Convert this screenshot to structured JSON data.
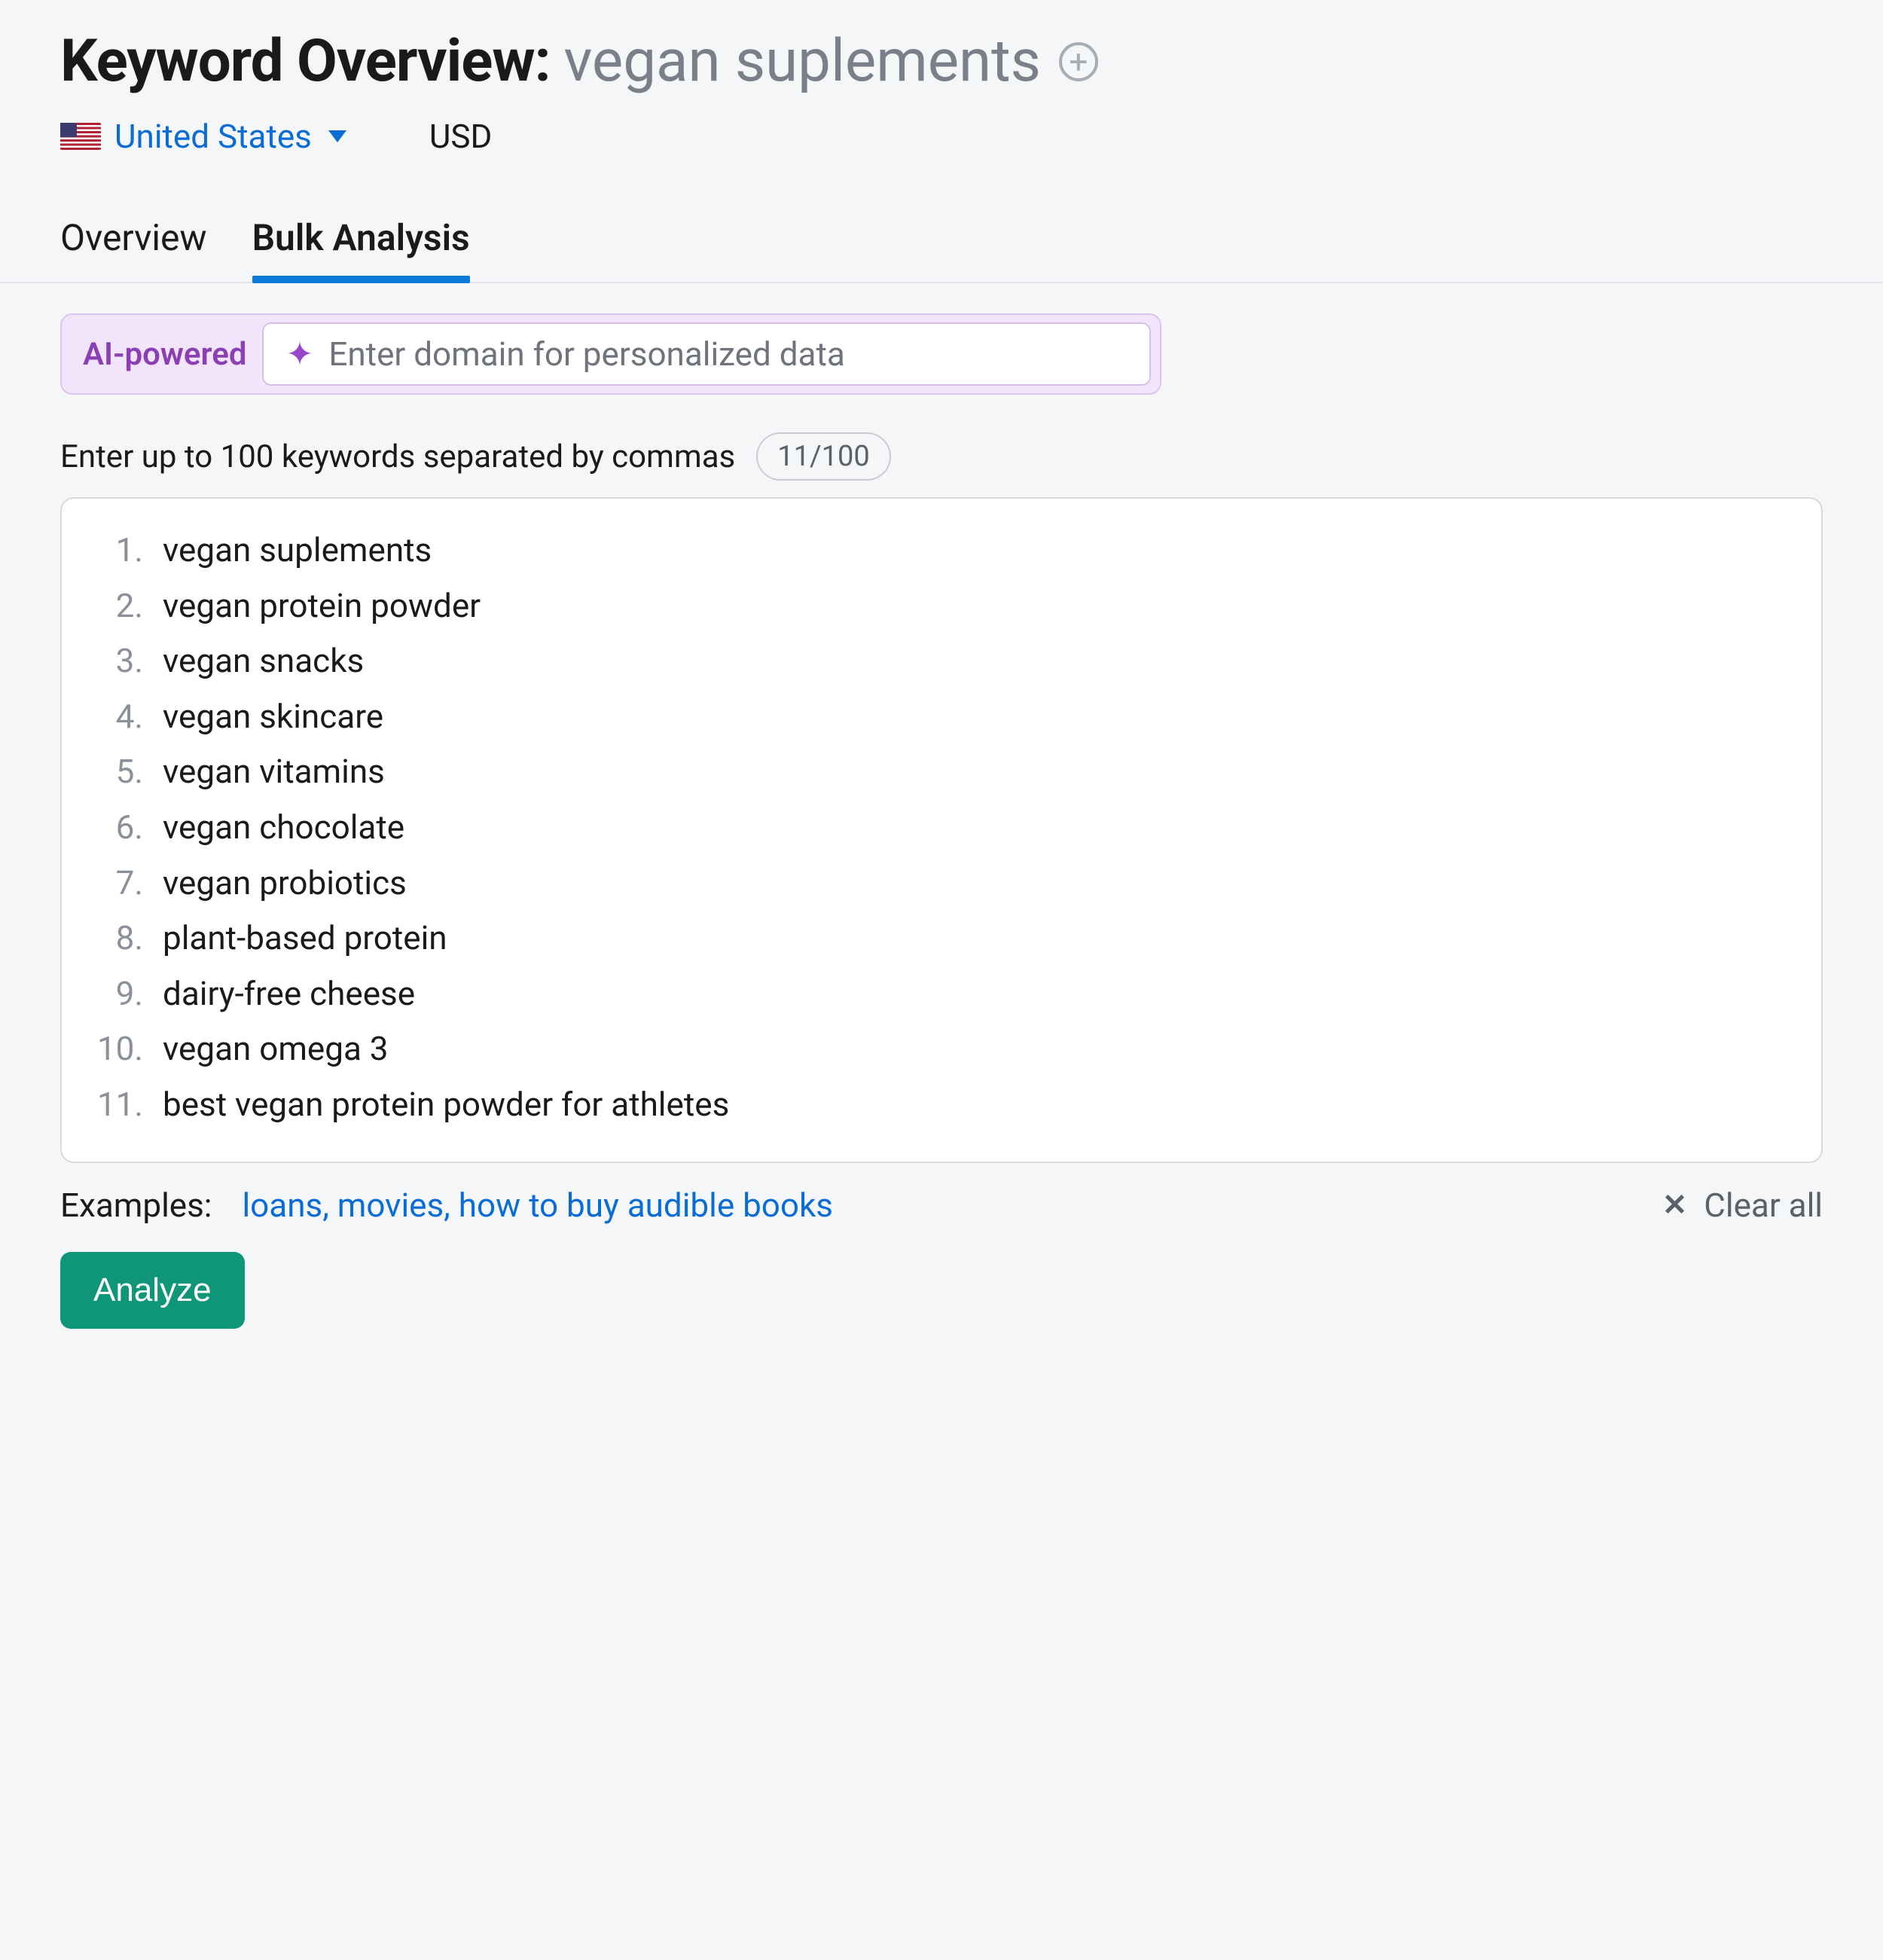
{
  "header": {
    "title_prefix": "Keyword Overview:",
    "keyword": "vegan suplements",
    "country": "United States",
    "currency": "USD"
  },
  "tabs": {
    "overview_label": "Overview",
    "bulk_label": "Bulk Analysis",
    "active": "bulk"
  },
  "ai": {
    "badge": "AI-powered",
    "placeholder": "Enter domain for personalized data"
  },
  "counter": {
    "label": "Enter up to 100 keywords separated by commas",
    "count_text": "11/100"
  },
  "keywords": [
    "vegan suplements",
    "vegan protein powder",
    "vegan snacks",
    "vegan skincare",
    "vegan vitamins",
    "vegan chocolate",
    "vegan probiotics",
    "plant-based protein",
    "dairy-free cheese",
    "vegan omega 3",
    "best vegan protein powder for athletes"
  ],
  "examples": {
    "label": "Examples:",
    "link_text": "loans, movies, how to buy audible books",
    "clear_label": "Clear all"
  },
  "actions": {
    "analyze_label": "Analyze"
  }
}
